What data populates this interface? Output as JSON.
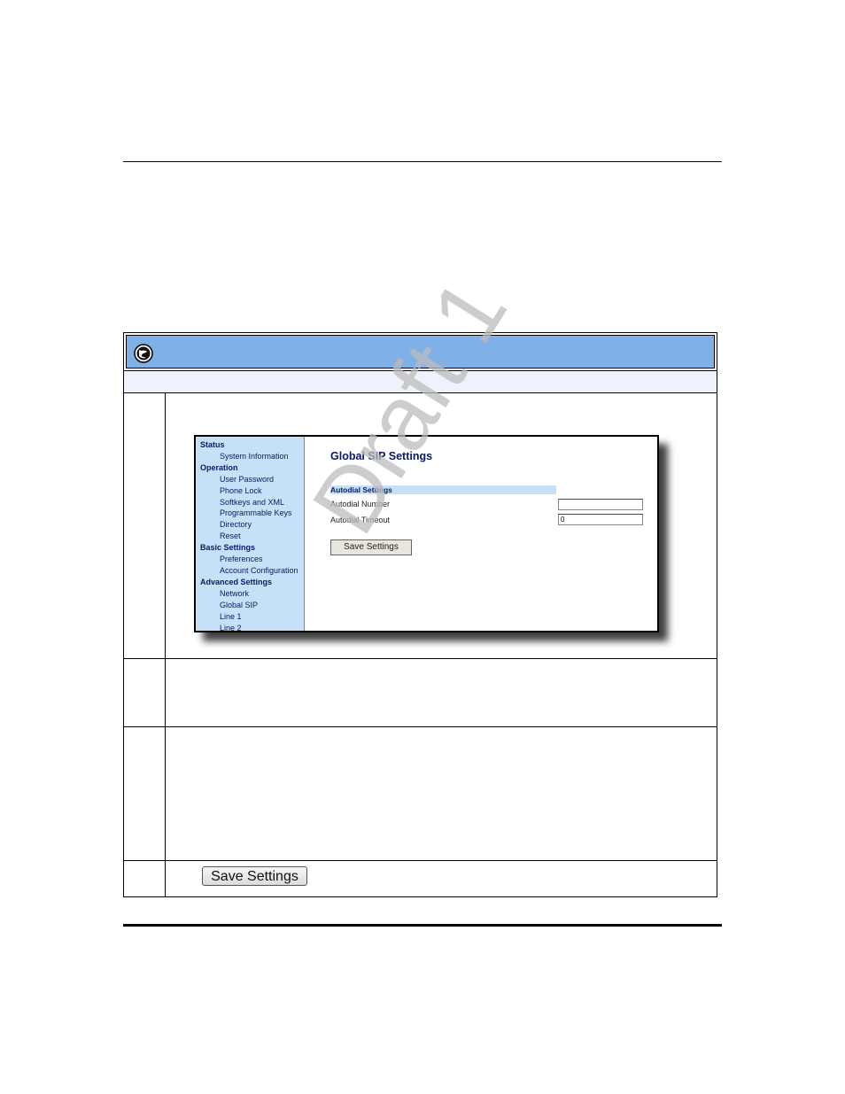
{
  "webui": {
    "nav": [
      {
        "type": "section",
        "label": "Status"
      },
      {
        "type": "item",
        "label": "System Information"
      },
      {
        "type": "section",
        "label": "Operation"
      },
      {
        "type": "item",
        "label": "User Password"
      },
      {
        "type": "item",
        "label": "Phone Lock"
      },
      {
        "type": "item",
        "label": "Softkeys and XML"
      },
      {
        "type": "item",
        "label": "Programmable Keys"
      },
      {
        "type": "item",
        "label": "Directory"
      },
      {
        "type": "item",
        "label": "Reset"
      },
      {
        "type": "section",
        "label": "Basic Settings"
      },
      {
        "type": "item",
        "label": "Preferences"
      },
      {
        "type": "item",
        "label": "Account Configuration"
      },
      {
        "type": "section",
        "label": "Advanced Settings"
      },
      {
        "type": "item",
        "label": "Network"
      },
      {
        "type": "item",
        "label": "Global SIP"
      },
      {
        "type": "item",
        "label": "Line 1"
      },
      {
        "type": "item",
        "label": "Line 2"
      }
    ],
    "title": "Global SIP Settings",
    "section_bar": "Autodial Settings",
    "fields": {
      "autodial_number_label": "Autodial Number",
      "autodial_number_value": "",
      "autodial_timeout_label": "Autodial Timeout",
      "autodial_timeout_value": "0"
    },
    "save_label": "Save Settings"
  },
  "save_button_label": "Save Settings",
  "watermark": "Draft 1",
  "icons": {
    "header_icon": "globe-icon"
  },
  "colors": {
    "header_bar": "#7fb0e6",
    "nav_bg": "#c5e0f7",
    "nav_text": "#0a1a66"
  }
}
